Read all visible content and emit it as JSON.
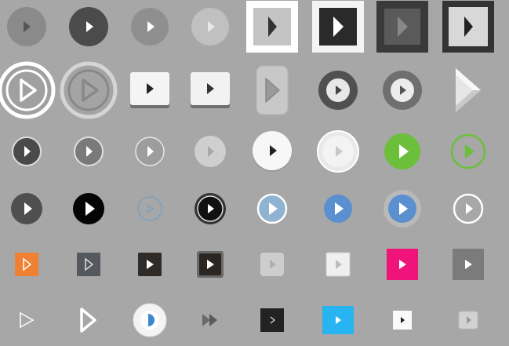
{
  "background": "#a7a7a7",
  "icons": [
    [
      "play-circle-grey",
      "play-circle-dark",
      "play-circle-mid-grey",
      "play-circle-light-faded",
      "play-square-framed-white",
      "play-square-dark-framed-white",
      "play-square-dark-beveled",
      "play-square-light-framed-dark"
    ],
    [
      "play-circle-large-white-ring",
      "play-circle-large-grey-ring",
      "play-key-white",
      "play-key-white-wide",
      "play-pill-vertical",
      "play-ring-dark",
      "play-ring-grey",
      "play-arrow-3d"
    ],
    [
      "play-circle-dark-small",
      "play-circle-grey-outline",
      "play-circle-light-outline",
      "play-circle-faded",
      "play-circle-white-shadow",
      "play-circle-white-glossy",
      "play-circle-green-filled",
      "play-circle-green-outline"
    ],
    [
      "play-circle-dark-grey",
      "play-circle-black",
      "play-circle-thin-blue-outline",
      "play-circle-black-ring",
      "play-circle-steel-blue",
      "play-circle-blue",
      "play-circle-blue-glow",
      "play-circle-white-outline"
    ],
    [
      "play-square-orange",
      "play-square-slate-outline",
      "play-square-dark-brown",
      "play-square-dark-beveled-small",
      "play-square-light-faded",
      "play-square-white-light",
      "play-square-magenta",
      "play-square-grey"
    ],
    [
      "play-triangle-outline-thin",
      "play-triangle-outline-bold",
      "play-circle-white-blue",
      "play-fast-forward",
      "play-square-black-chevron",
      "play-square-cyan",
      "play-square-white-small",
      "play-square-silver"
    ]
  ],
  "colors": {
    "orange": "#f08032",
    "magenta": "#f0137a",
    "green": "#6bbf3b",
    "blue": "#5a8fd0",
    "cyan": "#28b4f0",
    "steel": "#8fb3d0"
  }
}
